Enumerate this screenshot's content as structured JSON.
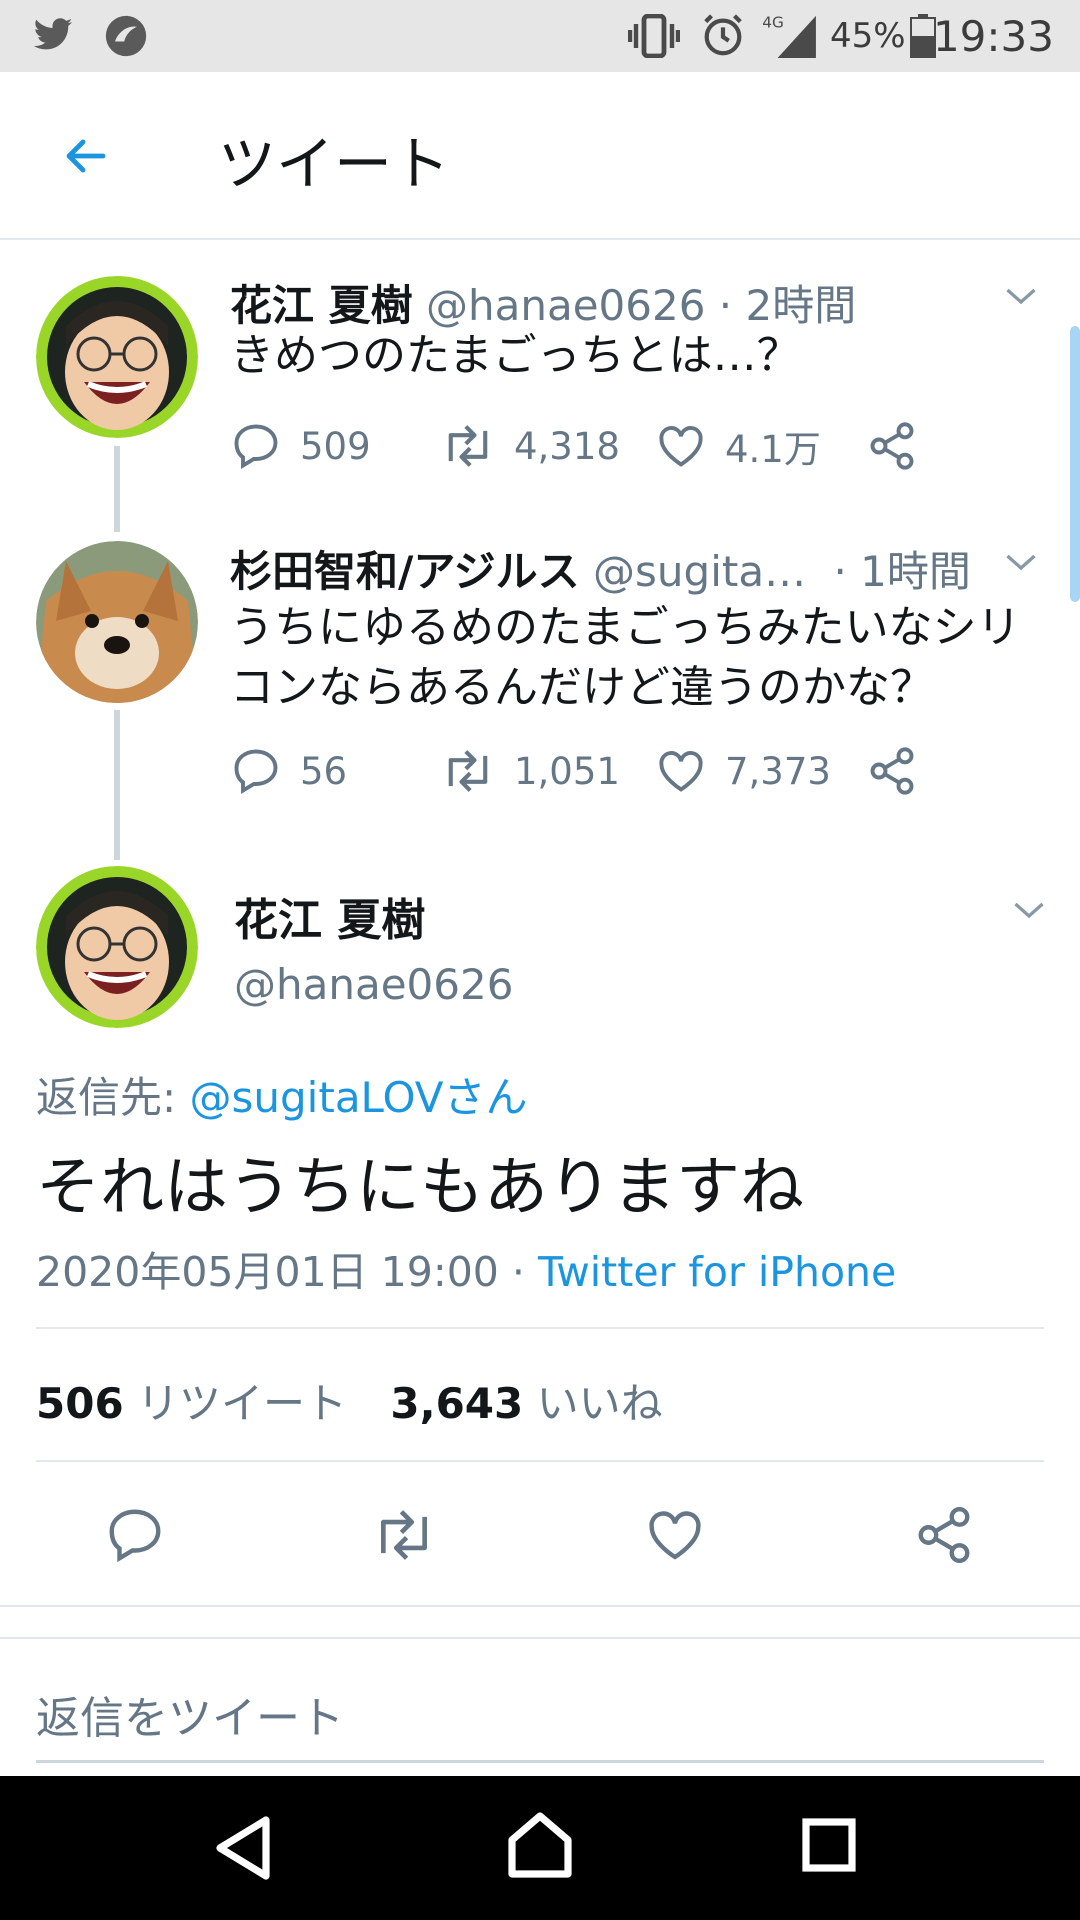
{
  "status_bar": {
    "battery": "45%",
    "time": "19:33"
  },
  "header": {
    "title": "ツイート"
  },
  "tweets": [
    {
      "name": "花江 夏樹",
      "handle": "@hanae0626",
      "time": "· 2時間",
      "text": "きめつのたまごっちとは…？",
      "replies": "509",
      "retweets": "4,318",
      "likes": "4.1万"
    },
    {
      "name": "杉田智和/アジルス",
      "handle": "@sugita…",
      "time": "· 1時間",
      "text": "うちにゆるめのたまごっちみたいなシリコンならあるんだけど違うのかな？",
      "replies": "56",
      "retweets": "1,051",
      "likes": "7,373"
    }
  ],
  "main_tweet": {
    "name": "花江 夏樹",
    "handle": "@hanae0626",
    "reply_to_label": "返信先:",
    "reply_to_handle": "@sugitaLOVさん",
    "text": "それはうちにもありますね",
    "timestamp": "2020年05月01日 19:00 ·",
    "source": "Twitter for iPhone",
    "retweet_count": "506",
    "retweet_label": "リツイート",
    "like_count": "3,643",
    "like_label": "いいね"
  },
  "reply_box": {
    "placeholder": "返信をツイート"
  },
  "colors": {
    "accent": "#1b95e0",
    "muted": "#657786",
    "line": "#ccd6dd"
  }
}
